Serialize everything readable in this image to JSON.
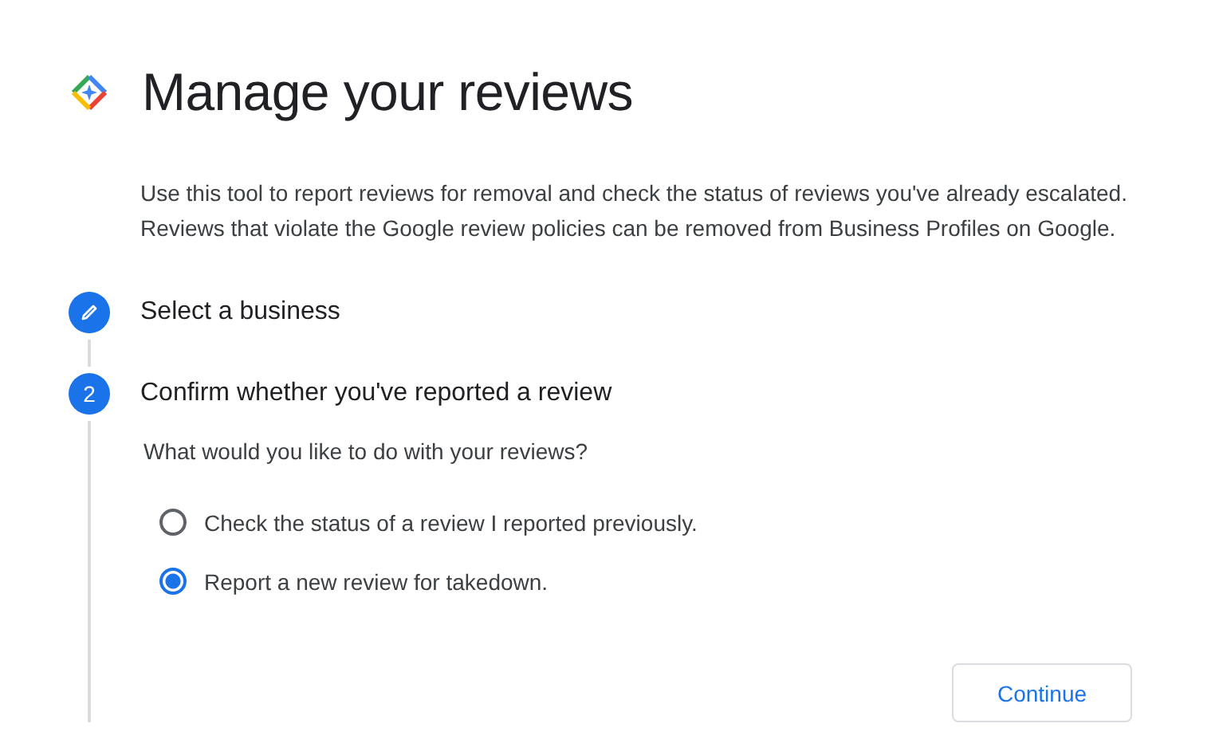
{
  "title": "Manage your reviews",
  "description": "Use this tool to report reviews for removal and check the status of reviews you've already escalated. Reviews that violate the Google review policies can be removed from Business Profiles on Google.",
  "steps": [
    {
      "kind": "edit",
      "label": "Select a business"
    },
    {
      "kind": "number",
      "number": "2",
      "label": "Confirm whether you've reported a review"
    }
  ],
  "question": "What would you like to do with your reviews?",
  "options": [
    {
      "label": "Check the status of a review I reported previously.",
      "selected": false
    },
    {
      "label": "Report a new review for takedown.",
      "selected": true
    }
  ],
  "button": "Continue"
}
